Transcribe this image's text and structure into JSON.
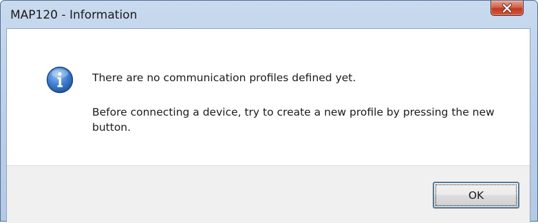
{
  "window": {
    "title": "MAP120 - Information"
  },
  "message": {
    "line1": "There are no communication profiles defined yet.",
    "line2": "Before connecting a device, try to create a new profile by pressing the new button."
  },
  "buttons": {
    "ok_label": "OK"
  },
  "icons": {
    "main": "information-icon",
    "close": "close-icon"
  },
  "colors": {
    "close_button": "#c3391f",
    "info_icon": "#2f6fc4",
    "button_focus": "#3c7fb1"
  }
}
